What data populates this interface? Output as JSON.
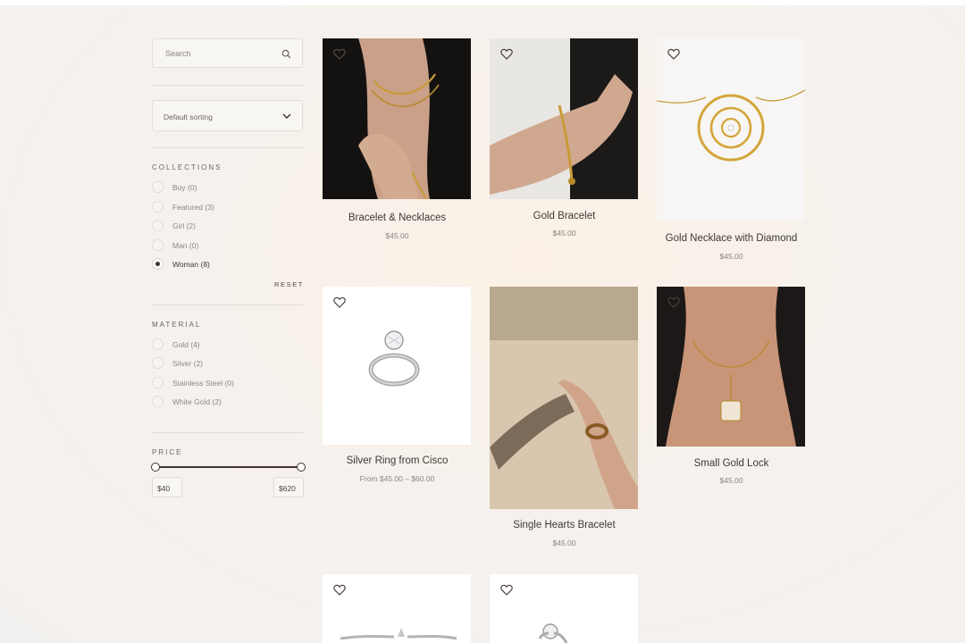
{
  "search": {
    "placeholder": "Search"
  },
  "sorting": {
    "selected": "Default sorting"
  },
  "collections": {
    "title": "COLLECTIONS",
    "items": [
      {
        "label": "Boy (0)",
        "selected": false
      },
      {
        "label": "Featured (3)",
        "selected": false
      },
      {
        "label": "Girl (2)",
        "selected": false
      },
      {
        "label": "Man (0)",
        "selected": false
      },
      {
        "label": "Woman (8)",
        "selected": true
      }
    ],
    "reset_label": "RESET"
  },
  "material": {
    "title": "MATERIAL",
    "items": [
      {
        "label": "Gold (4)"
      },
      {
        "label": "Silver (2)"
      },
      {
        "label": "Stainless Steel (0)"
      },
      {
        "label": "White Gold (2)"
      }
    ]
  },
  "price": {
    "title": "PRICE",
    "min": "$40",
    "max": "$620"
  },
  "products": [
    {
      "title": "Bracelet & Necklaces",
      "price": "$45.00"
    },
    {
      "title": "Gold Bracelet",
      "price": "$45.00"
    },
    {
      "title": "Gold Necklace with Diamond",
      "price": "$45.00"
    },
    {
      "title": "Silver Ring from Cisco",
      "price": "From $45.00 – $60.00"
    },
    {
      "title": "Single Hearts Bracelet",
      "price": "$45.00"
    },
    {
      "title": "Small Gold Lock",
      "price": "$45.00"
    }
  ],
  "icons": {
    "search": "search-icon",
    "dropdown": "chevron-down-icon",
    "wishlist": "heart-icon"
  },
  "colors": {
    "accent": "#3f3431",
    "background": "#f5f1ec"
  }
}
